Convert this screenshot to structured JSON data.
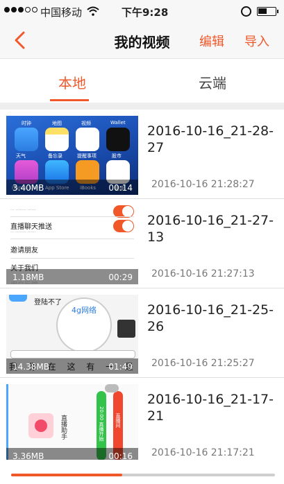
{
  "status_bar": {
    "carrier": "中国移动",
    "time": "下午9:28"
  },
  "nav": {
    "title": "我的视频",
    "edit": "编辑",
    "import": "导入"
  },
  "tabs": {
    "local": "本地",
    "cloud": "云端",
    "active": "local"
  },
  "thumb1": {
    "labels": [
      "时钟",
      "地图",
      "视频",
      "Wallet",
      "天气",
      "备忘录",
      "提醒事项",
      "股市",
      "iTunes Store",
      "App Store",
      "iBooks",
      "健康"
    ]
  },
  "thumb2": {
    "rows": [
      "直播聊天推送",
      "邀请朋友",
      "关于我们"
    ],
    "footer": "用户反馈"
  },
  "thumb3": {
    "bubble": "登陆不了",
    "network": "4g网络",
    "keyboard": "我 你 在 这 有 一 是"
  },
  "thumb4": {
    "label": "直播助手",
    "green_pill": "20:00 直播开始",
    "red_pill": "直播间"
  },
  "videos": [
    {
      "name": "2016-10-16_21-28-27",
      "date": "2016-10-16 21:28:27",
      "size": "3.40MB",
      "duration": "00:14"
    },
    {
      "name": "2016-10-16_21-27-13",
      "date": "2016-10-16 21:27:13",
      "size": "1.18MB",
      "duration": "00:29"
    },
    {
      "name": "2016-10-16_21-25-26",
      "date": "2016-10-16 21:25:27",
      "size": "14.38MB",
      "duration": "01:49"
    },
    {
      "name": "2016-10-16_21-17-21",
      "date": "2016-10-16 21:17:21",
      "size": "3.36MB",
      "duration": "00:16"
    }
  ],
  "storage_progress": 0.42,
  "colors": {
    "accent": "#f0582a"
  },
  "icons": [
    "back-chevron-icon",
    "wifi-icon",
    "rotation-lock-icon",
    "battery-icon"
  ]
}
